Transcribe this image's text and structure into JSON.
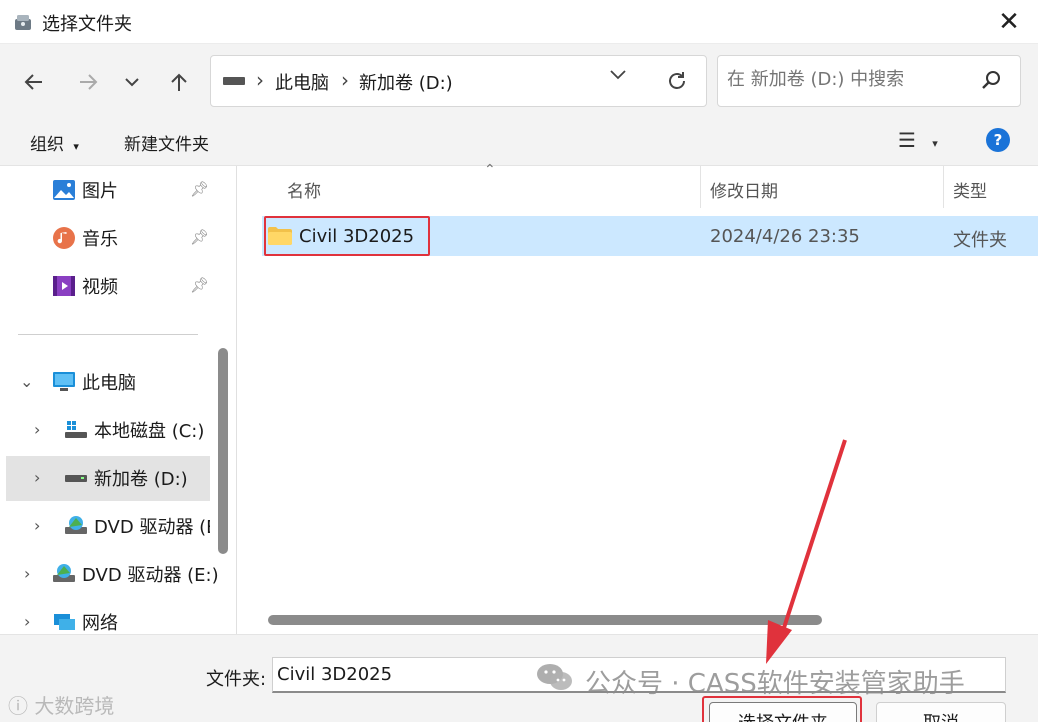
{
  "window": {
    "title": "选择文件夹",
    "close_icon": "close-icon"
  },
  "nav": {
    "back_icon": "arrow-left-icon",
    "forward_icon": "arrow-right-icon",
    "recent_icon": "chevron-down-icon",
    "up_icon": "arrow-up-icon",
    "breadcrumbs": [
      "此电脑",
      "新加卷 (D:)"
    ],
    "search_placeholder": "在 新加卷 (D:) 中搜索"
  },
  "toolbar": {
    "organize_label": "组织",
    "new_folder_label": "新建文件夹"
  },
  "sidebar": {
    "quick_access": [
      {
        "label": "图片",
        "icon": "pictures-icon"
      },
      {
        "label": "音乐",
        "icon": "music-icon"
      },
      {
        "label": "视频",
        "icon": "videos-icon"
      }
    ],
    "tree": [
      {
        "label": "此电脑",
        "icon": "computer-icon"
      },
      {
        "label": "本地磁盘 (C:)",
        "icon": "drive-c-icon"
      },
      {
        "label": "新加卷 (D:)",
        "icon": "drive-d-icon",
        "selected": true
      },
      {
        "label": "DVD 驱动器 (E",
        "icon": "dvd-icon"
      },
      {
        "label": "DVD 驱动器 (E:)",
        "icon": "dvd-icon"
      },
      {
        "label": "网络",
        "icon": "network-icon"
      }
    ]
  },
  "file_list": {
    "columns": [
      "名称",
      "修改日期",
      "类型"
    ],
    "rows": [
      {
        "name": "Civil 3D2025",
        "modified": "2024/4/26 23:35",
        "type": "文件夹",
        "selected": true
      }
    ]
  },
  "footer": {
    "folder_label": "文件夹:",
    "folder_value": "Civil 3D2025",
    "select_label": "选择文件夹",
    "cancel_label": "取消"
  },
  "watermarks": {
    "wechat_text": "公众号 · CASS软件安装管家助手",
    "corner_text": "大数跨境"
  },
  "colors": {
    "selection": "#cce8ff",
    "highlight": "#e0323c",
    "accent": "#1a73d8"
  }
}
